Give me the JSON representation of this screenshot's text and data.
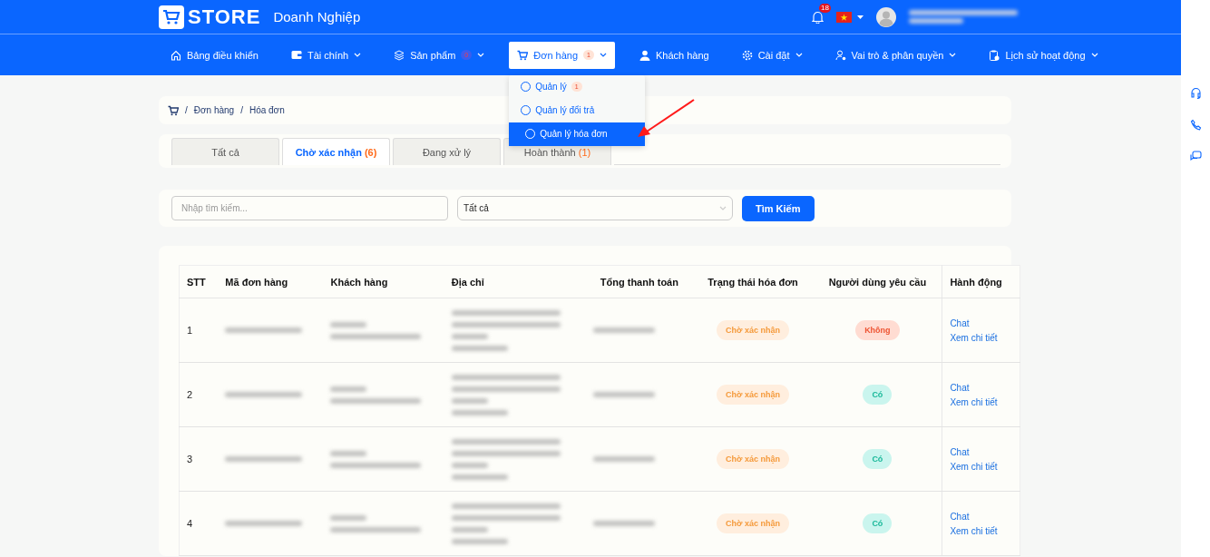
{
  "header": {
    "logo": "STORE",
    "subtitle": "Doanh Nghiệp",
    "notifications": "18"
  },
  "nav": [
    {
      "label": "Bảng điều khiển",
      "dropdown": false,
      "selected": false
    },
    {
      "label": "Tài chính",
      "dropdown": true,
      "selected": false
    },
    {
      "label": "Sản phẩm",
      "badge": "0",
      "dropdown": true,
      "selected": false
    },
    {
      "label": "Đơn hàng",
      "badge": "1",
      "dropdown": true,
      "selected": true,
      "menu": [
        {
          "label": "Quản lý",
          "badge": "1",
          "selected": false
        },
        {
          "label": "Quản lý đổi trả",
          "selected": false
        },
        {
          "label": "Quản lý hóa đơn",
          "selected": true
        }
      ]
    },
    {
      "label": "Khách hàng",
      "dropdown": false,
      "selected": false
    },
    {
      "label": "Cài đặt",
      "dropdown": true,
      "selected": false
    },
    {
      "label": "Vai trò & phân quyền",
      "dropdown": true,
      "selected": false
    },
    {
      "label": "Lịch sử hoạt động",
      "dropdown": true,
      "selected": false
    }
  ],
  "annotation": {
    "kind": "arrow"
  },
  "breadcrumb": {
    "separator": "/",
    "items": [
      "Đơn hàng",
      "Hóa đơn"
    ]
  },
  "tabs": [
    {
      "label": "Tất cả",
      "selected": false
    },
    {
      "label": "Chờ xác nhận",
      "count": "(6)",
      "selected": true
    },
    {
      "label": "Đang xử lý",
      "selected": false
    },
    {
      "label": "Hoàn thành",
      "count": "(1)",
      "selected": false
    }
  ],
  "search": {
    "placeholder": "Nhập tìm kiếm...",
    "filter": "Tất cả",
    "button": "Tìm Kiếm"
  },
  "table": {
    "columns": [
      {
        "label": "STT",
        "kind": "index"
      },
      {
        "label": "Mã đơn hàng",
        "kind": "redacted-short"
      },
      {
        "label": "Khách hàng",
        "kind": "redacted-two"
      },
      {
        "label": "Địa chỉ",
        "kind": "redacted-four"
      },
      {
        "label": "Tổng thanh toán",
        "kind": "redacted-short"
      },
      {
        "label": "Trạng thái hóa đơn",
        "kind": "status"
      },
      {
        "label": "Người dùng yêu cầu",
        "kind": "request"
      },
      {
        "label": "Hành động",
        "kind": "actions"
      }
    ],
    "rows": [
      {
        "stt": "1",
        "status": "Chờ xác nhận",
        "request": {
          "label": "Không",
          "on": false
        },
        "actions": [
          "Chat",
          "Xem chi tiết"
        ]
      },
      {
        "stt": "2",
        "status": "Chờ xác nhận",
        "request": {
          "label": "Có",
          "on": true
        },
        "actions": [
          "Chat",
          "Xem chi tiết"
        ]
      },
      {
        "stt": "3",
        "status": "Chờ xác nhận",
        "request": {
          "label": "Có",
          "on": true
        },
        "actions": [
          "Chat",
          "Xem chi tiết"
        ]
      },
      {
        "stt": "4",
        "status": "Chờ xác nhận",
        "request": {
          "label": "Có",
          "on": true
        },
        "actions": [
          "Chat",
          "Xem chi tiết"
        ]
      }
    ]
  }
}
